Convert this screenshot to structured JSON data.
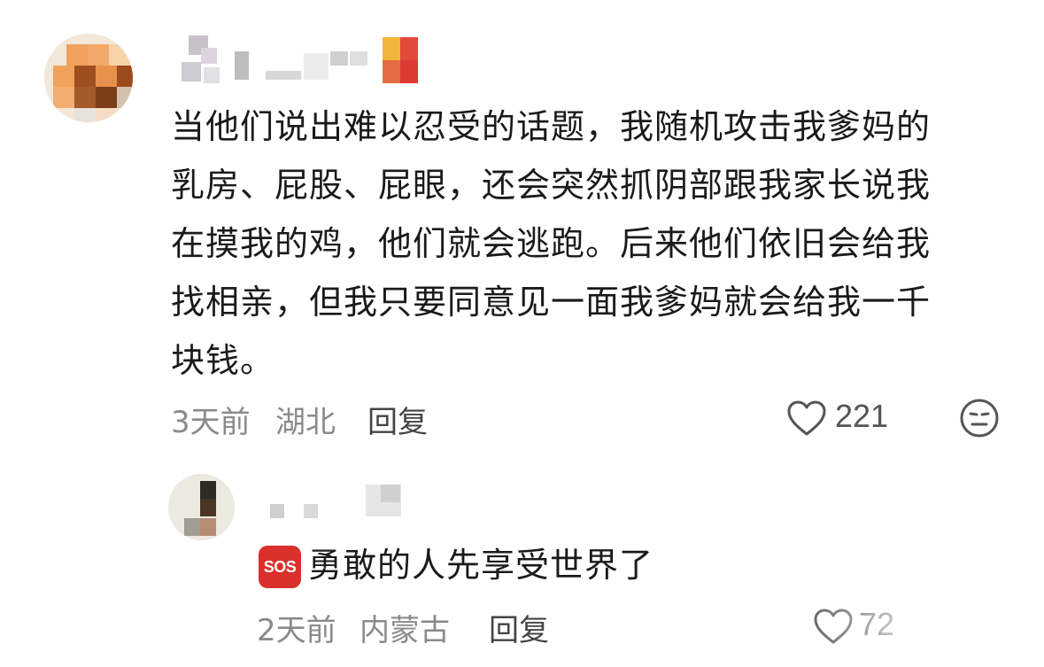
{
  "comment": {
    "lines": [
      "当他们说出难以忍受的话题，我随机攻击我爹妈的",
      "乳房、屁股、屁眼，还会突然抓阴部跟我家长说我",
      "在摸我的鸡，他们就会逃跑。后来他们依旧会给我",
      "找相亲，但我只要同意见一面我爹妈就会给我一千",
      "块钱。"
    ],
    "time": "3天前",
    "location": "湖北",
    "reply_label": "回复",
    "like_count": "221",
    "like_icon": "heart-icon",
    "emoji_icon": "smiley-icon"
  },
  "reply": {
    "emoji_badge": "SOS",
    "text": "勇敢的人先享受世界了",
    "time": "2天前",
    "location": "内蒙古",
    "reply_label": "回复",
    "like_count": "72"
  },
  "colors": {
    "text": "#1a1a1a",
    "meta": "#8a8a8a",
    "sos_bg": "#d9302c"
  }
}
